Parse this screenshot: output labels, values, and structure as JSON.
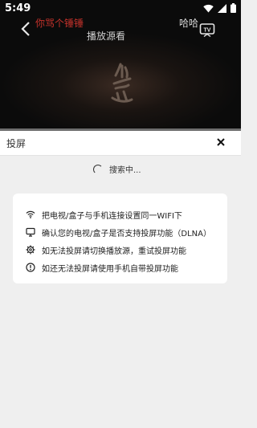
{
  "status_bar": {
    "time": "5:49",
    "icons": [
      "wifi-icon",
      "signal-icon",
      "battery-icon"
    ]
  },
  "video": {
    "title": "你骂个锤锤",
    "source_label": "播放源看",
    "right_label": "哈哈",
    "cast_icon": "tv-cast-icon",
    "back_icon": "chevron-left-icon"
  },
  "sheet": {
    "title": "投屏",
    "close_icon": "close-icon",
    "searching_text": "搜索中..."
  },
  "tips": [
    {
      "icon": "wifi-icon",
      "text": "把电视/盒子与手机连接设置同一WIFI下"
    },
    {
      "icon": "monitor-icon",
      "text": "确认您的电视/盒子是否支持投屏功能（DLNA）"
    },
    {
      "icon": "gear-icon",
      "text": "如无法投屏请切换播放源，重试投屏功能"
    },
    {
      "icon": "info-icon",
      "text": "如还无法投屏请使用手机自带投屏功能"
    }
  ]
}
